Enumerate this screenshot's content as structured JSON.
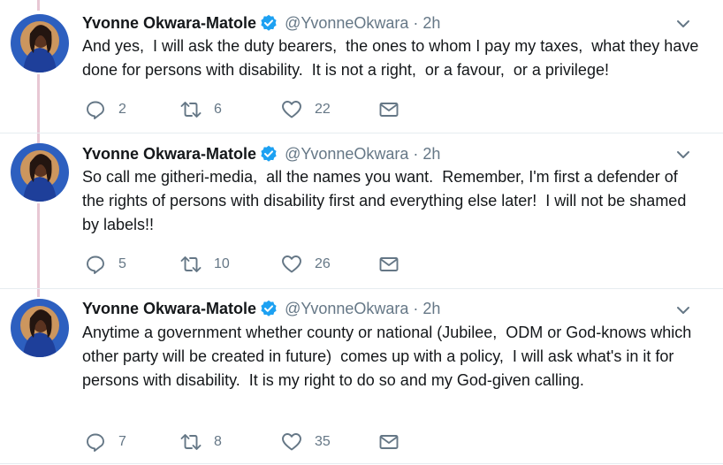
{
  "colors": {
    "text": "#14171a",
    "secondary": "#657786",
    "verified": "#1da1f2",
    "thread_line": "#e8c7d4",
    "divider": "#e6ecf0"
  },
  "icons": {
    "reply": "reply-icon",
    "retweet": "retweet-icon",
    "like": "heart-icon",
    "dm": "envelope-icon",
    "verified": "verified-badge-icon",
    "more": "chevron-down-icon"
  },
  "tweets": [
    {
      "author_name": "Yvonne Okwara-Matole",
      "handle": "@YvonneOkwara",
      "separator": "·",
      "time": "2h",
      "text": "And yes,  I will ask the duty bearers,  the ones to whom I pay my taxes,  what they have done for persons with disability.  It is not a right,  or a favour,  or a privilege!",
      "replies": "2",
      "retweets": "6",
      "likes": "22"
    },
    {
      "author_name": "Yvonne Okwara-Matole",
      "handle": "@YvonneOkwara",
      "separator": "·",
      "time": "2h",
      "text": "So call me githeri-media,  all the names you want.  Remember, I'm first a defender of the rights of persons with disability first and everything else later!  I will not be shamed by labels!!",
      "replies": "5",
      "retweets": "10",
      "likes": "26"
    },
    {
      "author_name": "Yvonne Okwara-Matole",
      "handle": "@YvonneOkwara",
      "separator": "·",
      "time": "2h",
      "text": "Anytime a government whether county or national (Jubilee,  ODM or God-knows which other party will be created in future)  comes up with a policy,  I will ask what's in it for persons with disability.  It is my right to do so and my God-given calling.",
      "replies": "7",
      "retweets": "8",
      "likes": "35"
    }
  ]
}
